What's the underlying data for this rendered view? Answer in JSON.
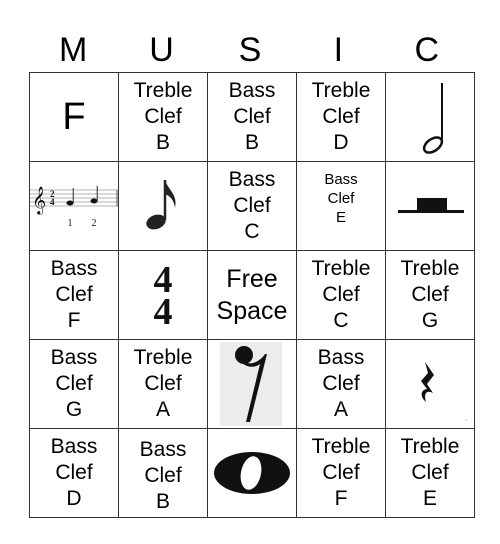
{
  "title_letters": [
    "M",
    "U",
    "S",
    "I",
    "C"
  ],
  "rows": [
    [
      {
        "type": "text",
        "text": "F",
        "style": "big"
      },
      {
        "type": "text",
        "text": "Treble\nClef\nB"
      },
      {
        "type": "text",
        "text": "Bass\nClef\nB"
      },
      {
        "type": "text",
        "text": "Treble\nClef\nD"
      },
      {
        "type": "icon",
        "icon": "half-note-icon"
      }
    ],
    [
      {
        "type": "icon",
        "icon": "staff-two-four-icon",
        "counts": [
          "1",
          "2"
        ]
      },
      {
        "type": "icon",
        "icon": "eighth-note-icon"
      },
      {
        "type": "text",
        "text": "Bass\nClef\nC"
      },
      {
        "type": "text",
        "text": "Bass\nClef\nE",
        "style": "small"
      },
      {
        "type": "icon",
        "icon": "half-rest-icon"
      }
    ],
    [
      {
        "type": "text",
        "text": "Bass\nClef\nF"
      },
      {
        "type": "icon",
        "icon": "time-signature-four-four-icon",
        "numerals": [
          "4",
          "4"
        ]
      },
      {
        "type": "text",
        "text": "Free\nSpace",
        "style": "free"
      },
      {
        "type": "text",
        "text": "Treble\nClef\nC"
      },
      {
        "type": "text",
        "text": "Treble\nClef\nG"
      }
    ],
    [
      {
        "type": "text",
        "text": "Bass\nClef\nG"
      },
      {
        "type": "text",
        "text": "Treble\nClef\nA"
      },
      {
        "type": "icon",
        "icon": "eighth-rest-icon"
      },
      {
        "type": "text",
        "text": "Bass\nClef\nA"
      },
      {
        "type": "icon",
        "icon": "quarter-rest-icon"
      }
    ],
    [
      {
        "type": "text",
        "text": "Bass\nClef\nD"
      },
      {
        "type": "text",
        "text": "Bass\nClef\nB"
      },
      {
        "type": "icon",
        "icon": "whole-note-icon"
      },
      {
        "type": "text",
        "text": "Treble\nClef\nF"
      },
      {
        "type": "text",
        "text": "Treble\nClef\nE"
      }
    ]
  ]
}
